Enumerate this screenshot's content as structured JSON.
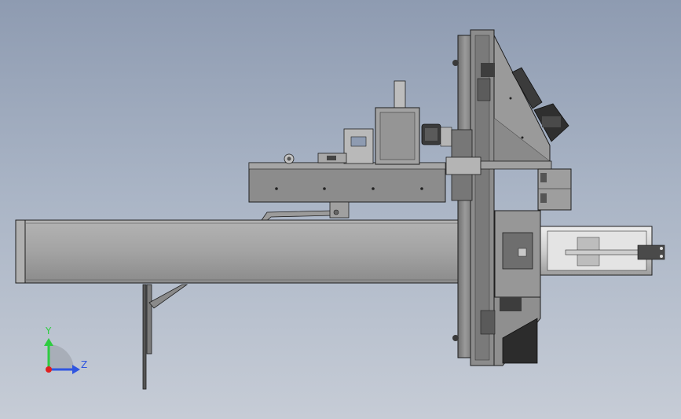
{
  "view": {
    "colors": {
      "background_top": "#8e9bb1",
      "background_bottom": "#c6ccd6",
      "part_light": "#a9a9a9",
      "part_mid": "#8f8f8f",
      "part_dark": "#5e5e5e",
      "edge": "#1e1e1e"
    }
  },
  "triad": {
    "y_label": "Y",
    "z_label": "Z",
    "y_color": "#2ecc40",
    "z_color": "#2f55e0",
    "x_color": "#e02020"
  }
}
